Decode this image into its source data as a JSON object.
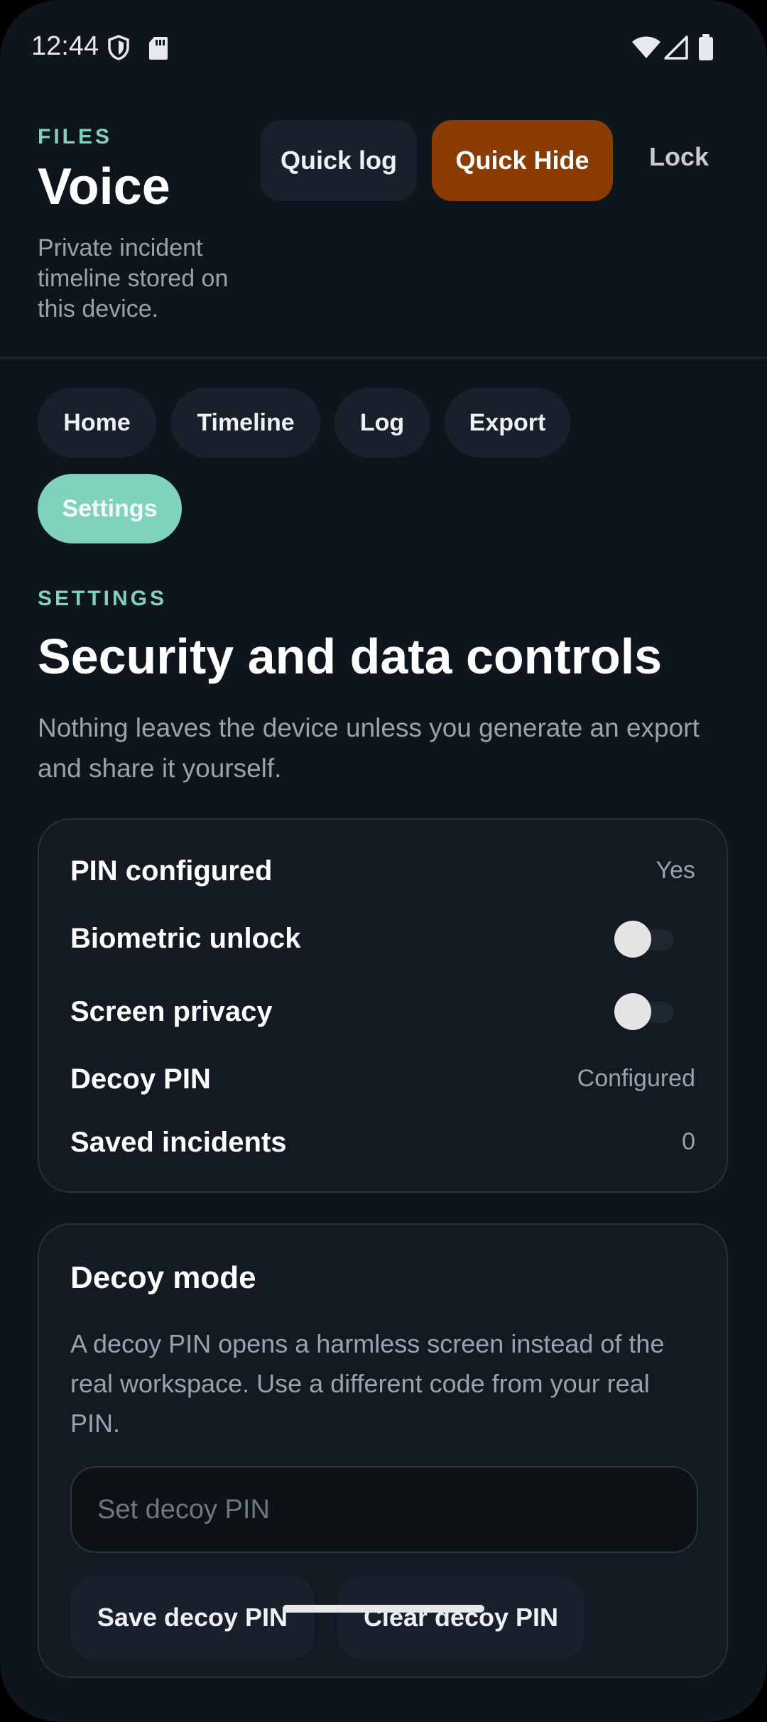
{
  "status_bar": {
    "time": "12:44",
    "icons": [
      "shield-icon",
      "sd-card-icon",
      "wifi-icon",
      "signal-icon",
      "battery-icon"
    ]
  },
  "header": {
    "eyebrow": "FILES",
    "title": "Voice",
    "subtitle": "Private incident timeline stored on this device.",
    "quick_log_label": "Quick log",
    "quick_hide_label": "Quick Hide",
    "lock_label": "Lock"
  },
  "tabs": [
    {
      "label": "Home",
      "active": false
    },
    {
      "label": "Timeline",
      "active": false
    },
    {
      "label": "Log",
      "active": false
    },
    {
      "label": "Export",
      "active": false
    },
    {
      "label": "Settings",
      "active": true
    }
  ],
  "settings": {
    "eyebrow": "SETTINGS",
    "title": "Security and data controls",
    "description": "Nothing leaves the device unless you generate an export and share it yourself.",
    "rows": {
      "pin_configured": {
        "label": "PIN configured",
        "value": "Yes"
      },
      "biometric_unlock": {
        "label": "Biometric unlock",
        "enabled": false
      },
      "screen_privacy": {
        "label": "Screen privacy",
        "enabled": false
      },
      "decoy_pin": {
        "label": "Decoy PIN",
        "value": "Configured"
      },
      "saved_incidents": {
        "label": "Saved incidents",
        "value": "0"
      }
    }
  },
  "decoy_mode": {
    "title": "Decoy mode",
    "description": "A decoy PIN opens a harmless screen instead of the real workspace. Use a different code from your real PIN.",
    "input_placeholder": "Set decoy PIN",
    "input_value": "",
    "save_label": "Save decoy PIN",
    "clear_label": "Clear decoy PIN"
  },
  "colors": {
    "background": "#0f151d",
    "accent": "#7fd3bd",
    "quick_hide": "#8a3c02",
    "surface": "#18212b"
  }
}
